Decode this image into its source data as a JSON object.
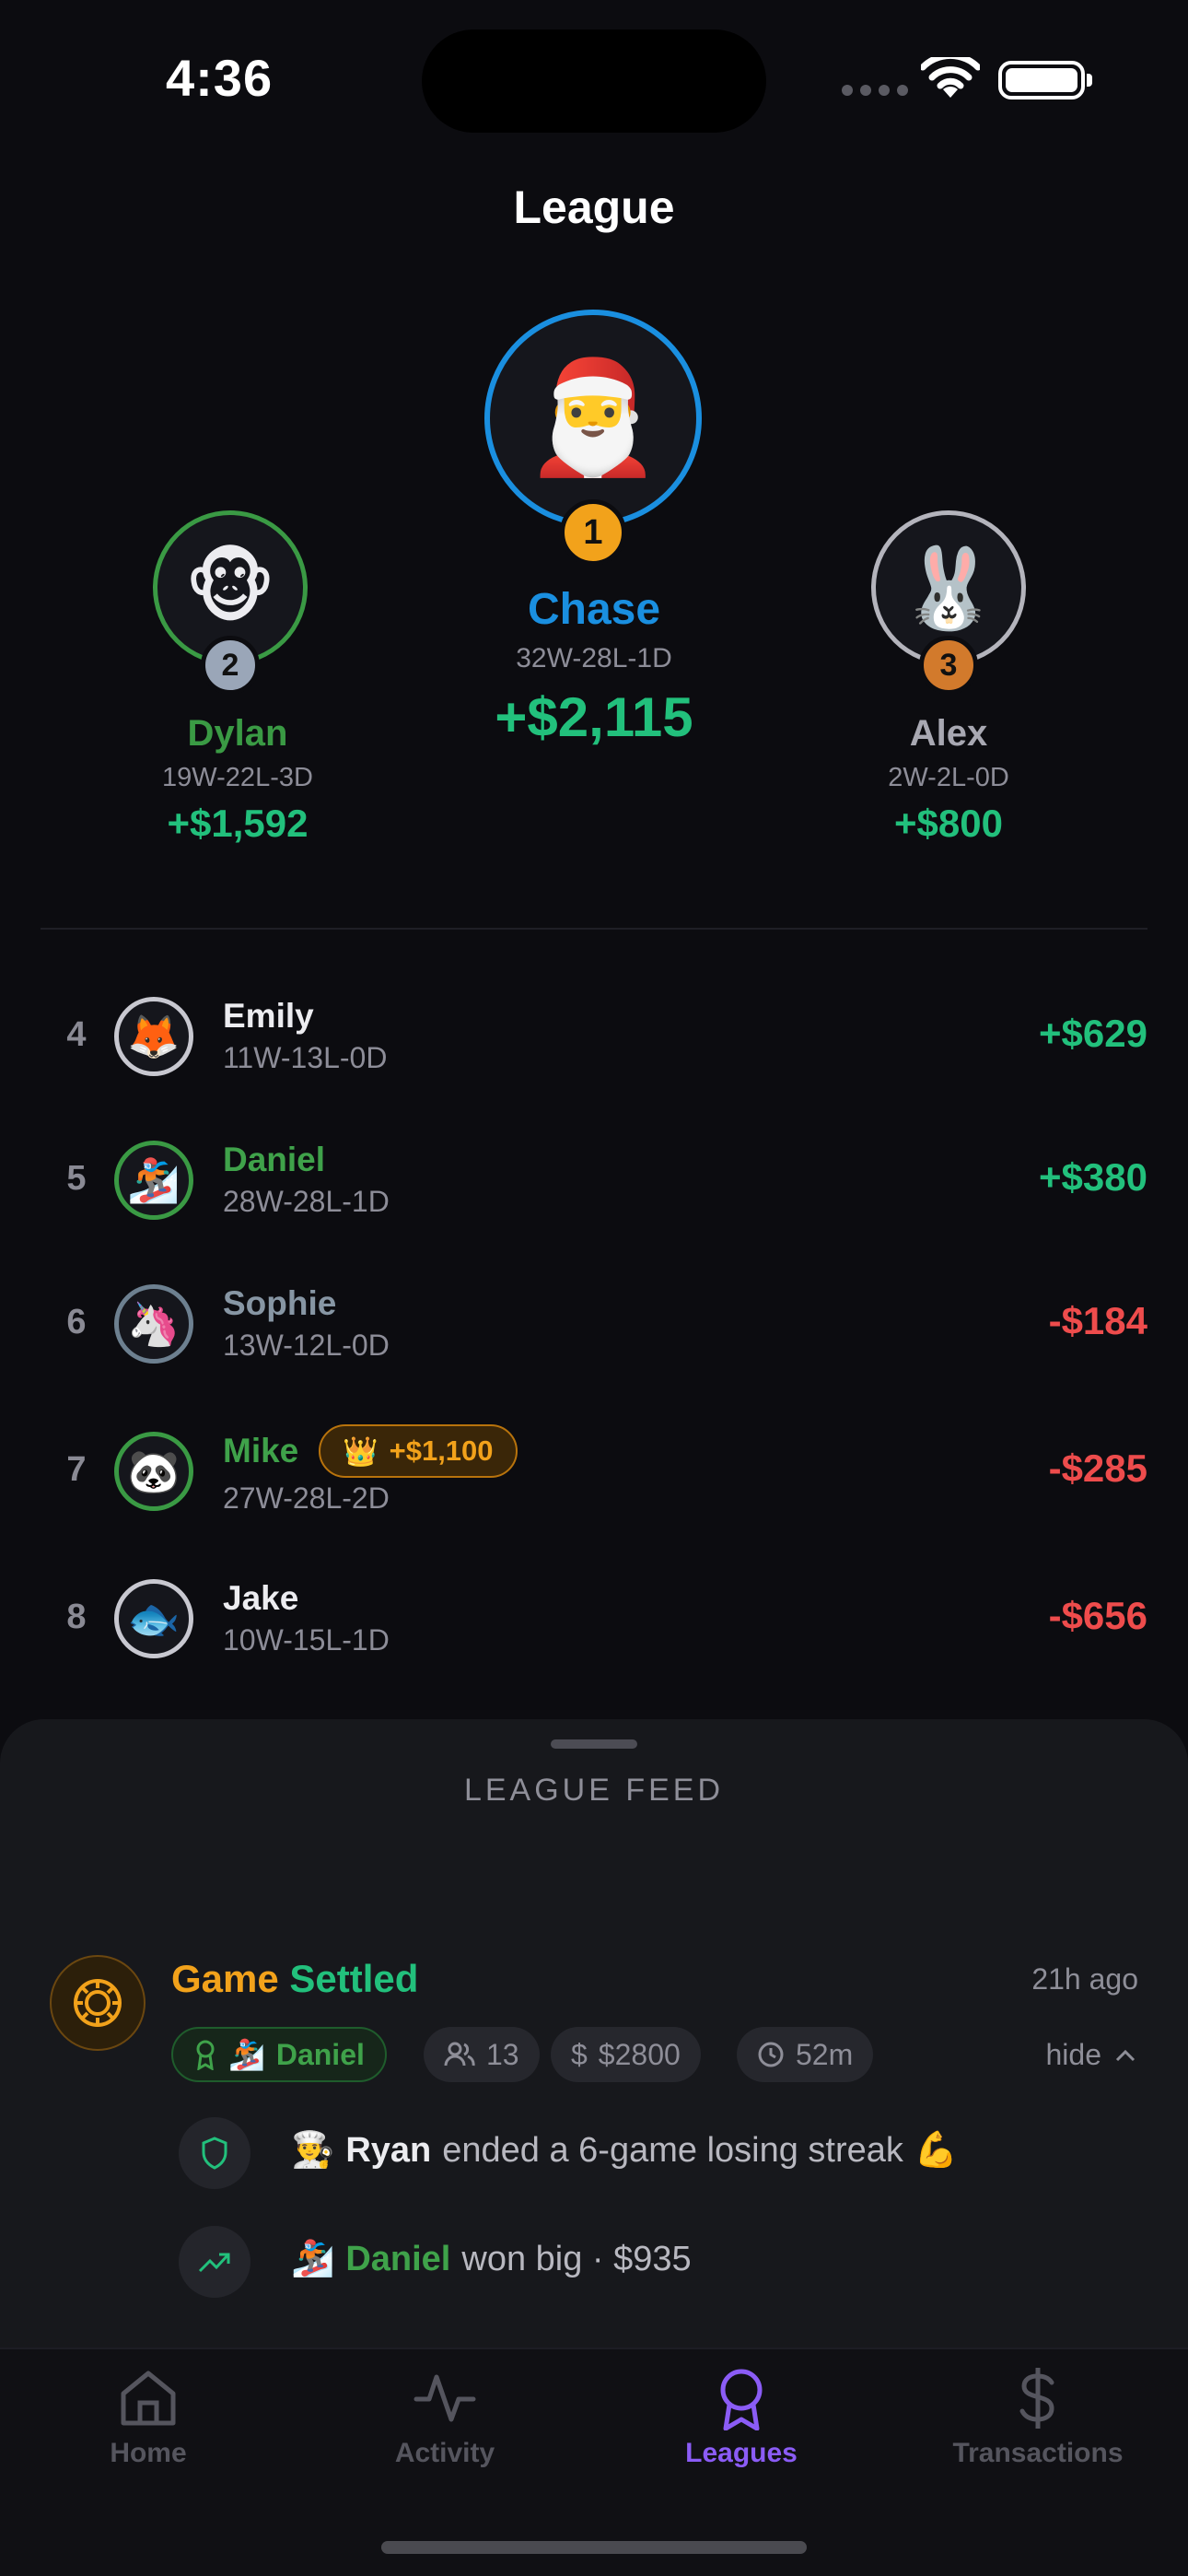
{
  "status_bar": {
    "time": "4:36"
  },
  "header": {
    "title": "League"
  },
  "podium": {
    "first": {
      "rank": "1",
      "emoji": "🎅",
      "name": "Chase",
      "record": "32W-28L-1D",
      "amount": "+$2,115",
      "color": "#1a8fe0"
    },
    "second": {
      "rank": "2",
      "emoji": "🐵",
      "name": "Dylan",
      "record": "19W-22L-3D",
      "amount": "+$1,592",
      "color": "#3a9a44"
    },
    "third": {
      "rank": "3",
      "emoji": "🐰",
      "name": "Alex",
      "record": "2W-2L-0D",
      "amount": "+$800",
      "color": "#b4b4bc"
    }
  },
  "standings": [
    {
      "rank": "4",
      "emoji": "🦊",
      "name": "Emily",
      "record": "11W-13L-0D",
      "amount": "+$629",
      "ring": "#c8c8d0",
      "name_color": "#ececf0",
      "positive": true
    },
    {
      "rank": "5",
      "emoji": "🏂",
      "name": "Daniel",
      "record": "28W-28L-1D",
      "amount": "+$380",
      "ring": "#3a9a44",
      "name_color": "#3fa24a",
      "positive": true
    },
    {
      "rank": "6",
      "emoji": "🦄",
      "name": "Sophie",
      "record": "13W-12L-0D",
      "amount": "-$184",
      "ring": "#6d8090",
      "name_color": "#8796a4",
      "positive": false
    },
    {
      "rank": "7",
      "emoji": "🐼",
      "name": "Mike",
      "record": "27W-28L-2D",
      "amount": "-$285",
      "ring": "#3a9a44",
      "name_color": "#3fa24a",
      "positive": false,
      "badge": {
        "emoji": "👑",
        "label": "+$1,100"
      }
    },
    {
      "rank": "8",
      "emoji": "🐟",
      "name": "Jake",
      "record": "10W-15L-1D",
      "amount": "-$656",
      "ring": "#c8c8d0",
      "name_color": "#ececf0",
      "positive": false
    }
  ],
  "feed": {
    "title": "LEAGUE FEED",
    "item": {
      "heading_part1": "Game",
      "heading_part2": "Settled",
      "time": "21h ago",
      "winner_emoji": "🏂",
      "winner": "Daniel",
      "players": "13",
      "pot": "$2800",
      "duration": "52m",
      "hide_label": "hide",
      "events": [
        {
          "icon": "shield-icon",
          "emoji": "👨‍🍳",
          "name": "Ryan",
          "text": "ended a 6-game losing streak",
          "suffix": "💪"
        },
        {
          "icon": "trending-up-icon",
          "emoji": "🏂",
          "name": "Daniel",
          "text": "won big · $935",
          "suffix": ""
        }
      ]
    }
  },
  "tabs": [
    {
      "label": "Home",
      "icon": "home-icon"
    },
    {
      "label": "Activity",
      "icon": "activity-icon"
    },
    {
      "label": "Leagues",
      "icon": "leagues-icon",
      "active": true
    },
    {
      "label": "Transactions",
      "icon": "dollar-icon"
    }
  ]
}
